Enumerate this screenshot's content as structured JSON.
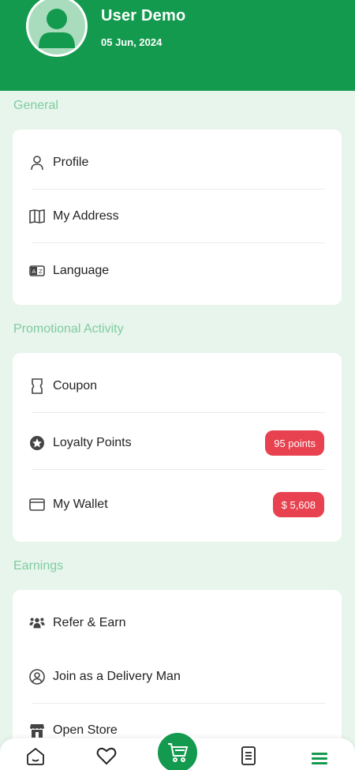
{
  "header": {
    "user_name": "User Demo",
    "date": "05 Jun, 2024",
    "bg_color": "#139a4e"
  },
  "sections": {
    "general": {
      "title": "General",
      "items": [
        {
          "label": "Profile",
          "icon": "person-icon"
        },
        {
          "label": "My Address",
          "icon": "map-icon"
        },
        {
          "label": "Language",
          "icon": "language-icon"
        }
      ]
    },
    "promotional": {
      "title": "Promotional Activity",
      "items": [
        {
          "label": "Coupon",
          "icon": "coupon-icon"
        },
        {
          "label": "Loyalty Points",
          "icon": "star-icon",
          "badge": "95 points"
        },
        {
          "label": "My Wallet",
          "icon": "wallet-icon",
          "badge": "$ 5,608"
        }
      ]
    },
    "earnings": {
      "title": "Earnings",
      "items": [
        {
          "label": "Refer & Earn",
          "icon": "group-icon"
        },
        {
          "label": "Join as a Delivery Man",
          "icon": "delivery-man-icon"
        },
        {
          "label": "Open Store",
          "icon": "store-icon"
        }
      ]
    }
  },
  "bottom_nav": {
    "items": [
      "home-icon",
      "favorite-icon",
      "cart-icon",
      "orders-icon",
      "menu-icon"
    ],
    "active": "menu-icon"
  },
  "colors": {
    "accent": "#139a4e",
    "section_title": "#7fcba0",
    "badge": "#e8414f",
    "background": "#e8f5ec"
  }
}
